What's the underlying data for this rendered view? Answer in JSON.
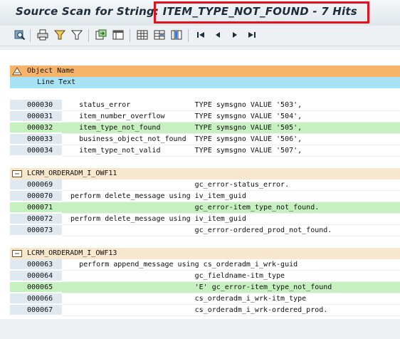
{
  "title": {
    "prefix": "Source Scan for String: ",
    "highlight": "ITEM_TYPE_NOT_FOUND - 7 Hits"
  },
  "toolbar": {
    "icons": [
      "find-icon",
      "print-icon",
      "filter-icon",
      "filter-set-icon",
      "export-icon",
      "layout-icon",
      "grid-icon",
      "sum-icon",
      "columns-icon",
      "first-page-icon",
      "previous-page-icon",
      "next-page-icon",
      "last-page-icon"
    ]
  },
  "header": {
    "object_name": "Object Name",
    "line_text": "Line Text"
  },
  "groups": [
    {
      "name": "",
      "rows": [
        {
          "line": "000030",
          "text": "    status_error               TYPE symsgno VALUE '503',",
          "hit": false
        },
        {
          "line": "000031",
          "text": "    item_number_overflow       TYPE symsgno VALUE '504',",
          "hit": false
        },
        {
          "line": "000032",
          "text": "    item_type_not_found        TYPE symsgno VALUE '505',",
          "hit": true
        },
        {
          "line": "000033",
          "text": "    business_object_not_found  TYPE symsgno VALUE '506',",
          "hit": false
        },
        {
          "line": "000034",
          "text": "    item_type_not_valid        TYPE symsgno VALUE '507',",
          "hit": false
        }
      ]
    },
    {
      "name": "LCRM_ORDERADM_I_OWF11",
      "rows": [
        {
          "line": "000069",
          "text": "                               gc_error-status_error.",
          "hit": false
        },
        {
          "line": "000070",
          "text": "  perform delete_message using iv_item_guid",
          "hit": false
        },
        {
          "line": "000071",
          "text": "                               gc_error-item_type_not_found.",
          "hit": true
        },
        {
          "line": "000072",
          "text": "  perform delete_message using iv_item_guid",
          "hit": false
        },
        {
          "line": "000073",
          "text": "                               gc_error-ordered_prod_not_found.",
          "hit": false
        }
      ]
    },
    {
      "name": "LCRM_ORDERADM_I_OWF13",
      "rows": [
        {
          "line": "000063",
          "text": "    perform append_message using cs_orderadm_i_wrk-guid",
          "hit": false
        },
        {
          "line": "000064",
          "text": "                               gc_fieldname-itm_type",
          "hit": false
        },
        {
          "line": "000065",
          "text": "                               'E' gc_error-item_type_not_found",
          "hit": true
        },
        {
          "line": "000066",
          "text": "                               cs_orderadm_i_wrk-itm_type",
          "hit": false
        },
        {
          "line": "000067",
          "text": "                               cs_orderadm_i_wrk-ordered_prod.",
          "hit": false
        }
      ]
    }
  ],
  "colors": {
    "hit_row": "#c7f0c0",
    "header_object": "#f6b46a",
    "header_line": "#a8e2f5",
    "group_row": "#f8e7cf",
    "title_highlight_border": "#e3121f"
  }
}
